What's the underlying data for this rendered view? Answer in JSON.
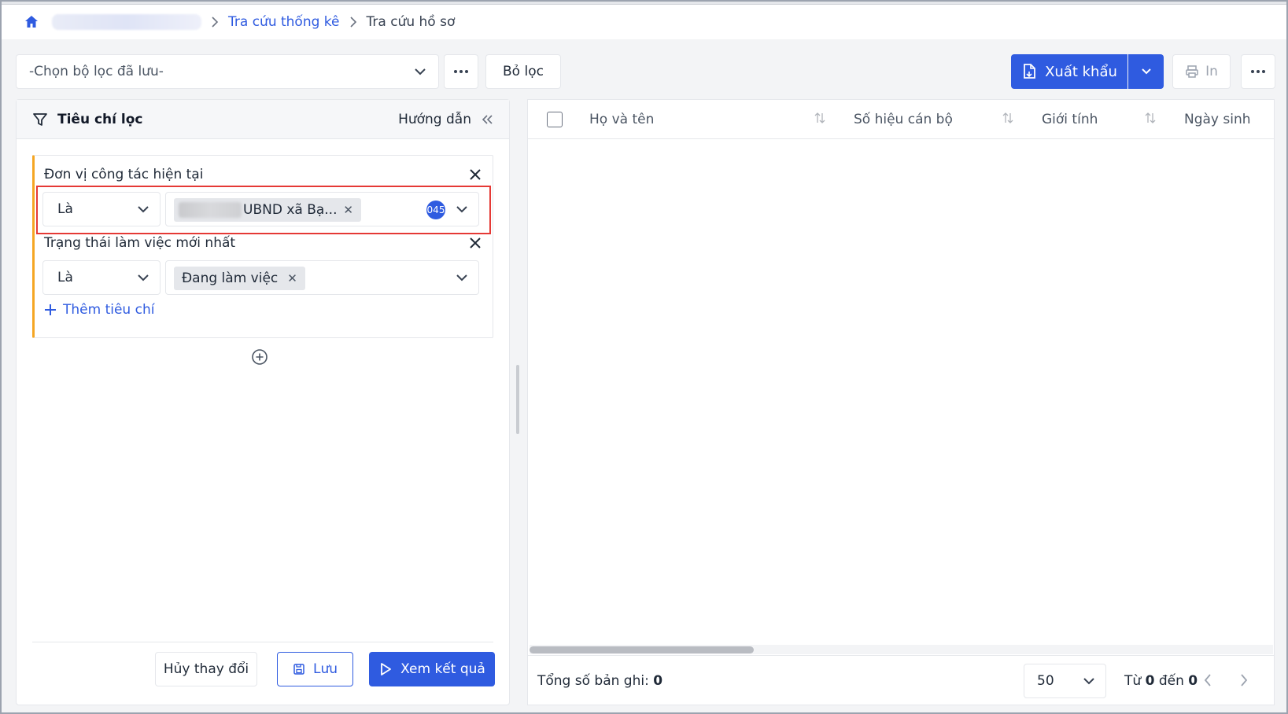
{
  "breadcrumb": {
    "items": [
      "Tra cứu thống kê",
      "Tra cứu hồ sơ"
    ]
  },
  "toolbar": {
    "saved_filter_placeholder": "-Chọn bộ lọc đã lưu-",
    "clear_filter_label": "Bỏ lọc",
    "export_label": "Xuất khẩu",
    "print_label": "In"
  },
  "filter_panel": {
    "title": "Tiêu chí lọc",
    "guide_label": "Hướng dẫn",
    "criteria": [
      {
        "label": "Đơn vị công tác hiện tại",
        "operator": "Là",
        "tag": "UBND xã Bạ...",
        "count_badge": "045"
      },
      {
        "label": "Trạng thái làm việc mới nhất",
        "operator": "Là",
        "tag": "Đang làm việc"
      }
    ],
    "add_criterion_label": "Thêm tiêu chí",
    "cancel_label": "Hủy thay đổi",
    "save_label": "Lưu",
    "view_results_label": "Xem kết quả"
  },
  "table": {
    "columns": [
      "Họ và tên",
      "Số hiệu cán bộ",
      "Giới tính",
      "Ngày sinh"
    ],
    "rows": [],
    "total_label": "Tổng số bản ghi:",
    "total_value": "0",
    "page_size": "50",
    "range_from_label": "Từ",
    "range_from": "0",
    "range_to_label": "đến",
    "range_to": "0"
  },
  "colors": {
    "accent": "#2f5be0",
    "criteria_border": "#f5a623",
    "highlight": "#e53935"
  }
}
